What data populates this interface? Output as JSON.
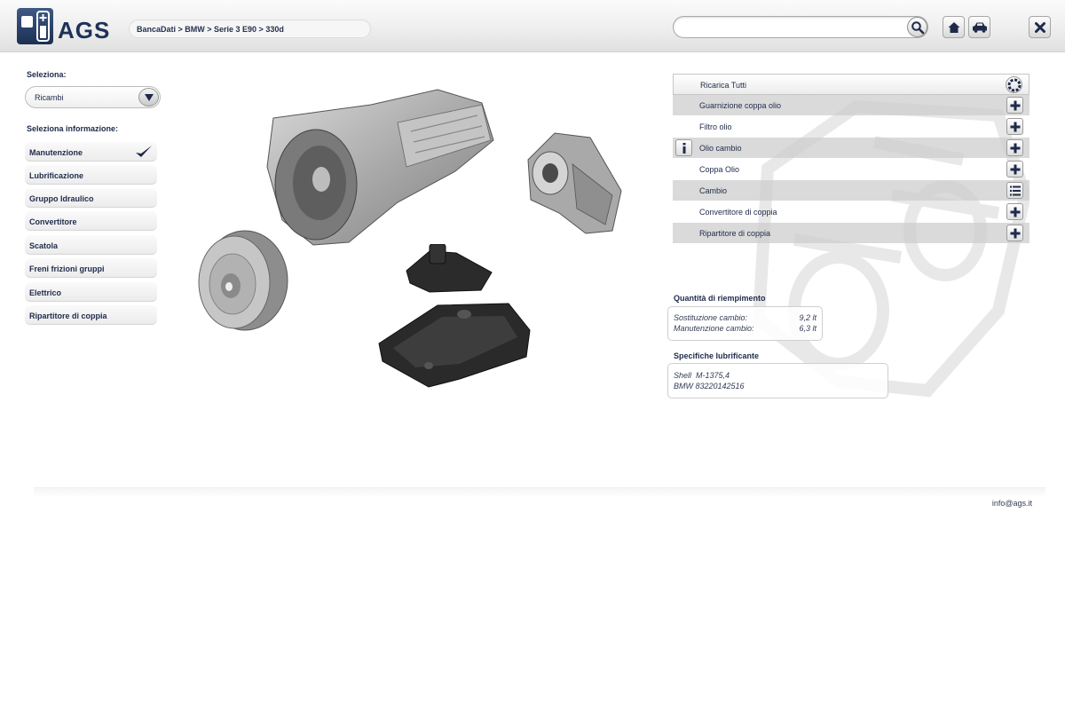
{
  "header": {
    "logo_text": "AGS",
    "breadcrumb": "BancaDati > BMW > Serie 3 E90 > 330d",
    "search": {
      "value": "",
      "placeholder": ""
    },
    "icons": [
      "search-icon",
      "home-icon",
      "car-icon",
      "close-icon"
    ]
  },
  "sidebar": {
    "select_label": "Seleziona:",
    "select_value": "Ricambi",
    "info_label": "Seleziona informazione:",
    "categories": [
      {
        "label": "Manutenzione",
        "selected": true
      },
      {
        "label": "Lubrificazione"
      },
      {
        "label": "Gruppo Idraulico"
      },
      {
        "label": "Convertitore"
      },
      {
        "label": "Scatola"
      },
      {
        "label": "Freni frizioni gruppi"
      },
      {
        "label": "Elettrico"
      },
      {
        "label": "Ripartitore di coppia"
      }
    ]
  },
  "parts": {
    "reload_all": "Ricarica Tutti",
    "items": [
      {
        "label": "Guarnizione coppa olio",
        "action_icon": "plus-icon"
      },
      {
        "label": "Filtro olio",
        "action_icon": "plus-icon"
      },
      {
        "label": "Olio cambio",
        "action_icon": "plus-icon",
        "info_icon": "info-icon"
      },
      {
        "label": "Coppa Olio",
        "action_icon": "plus-icon"
      },
      {
        "label": "Cambio",
        "action_icon": "list-icon"
      },
      {
        "label": "Convertitore di coppia",
        "action_icon": "plus-icon"
      },
      {
        "label": "Ripartitore di coppia",
        "action_icon": "plus-icon"
      }
    ]
  },
  "fill": {
    "title": "Quantità di riempimento",
    "rows": [
      {
        "label": "Sostituzione cambio:",
        "value": "9,2 lt"
      },
      {
        "label": "Manutenzione cambio:",
        "value": "6,3 lt"
      }
    ]
  },
  "lubricant": {
    "title": "Specifiche lubrificante",
    "lines": [
      "Shell  M-1375,4",
      "BMW 83220142516"
    ]
  },
  "footer": {
    "email": "info@ags.it"
  },
  "colors": {
    "brand": "#1e3258",
    "text": "#1e2a4a",
    "row_shade": "#cdcdcd"
  }
}
